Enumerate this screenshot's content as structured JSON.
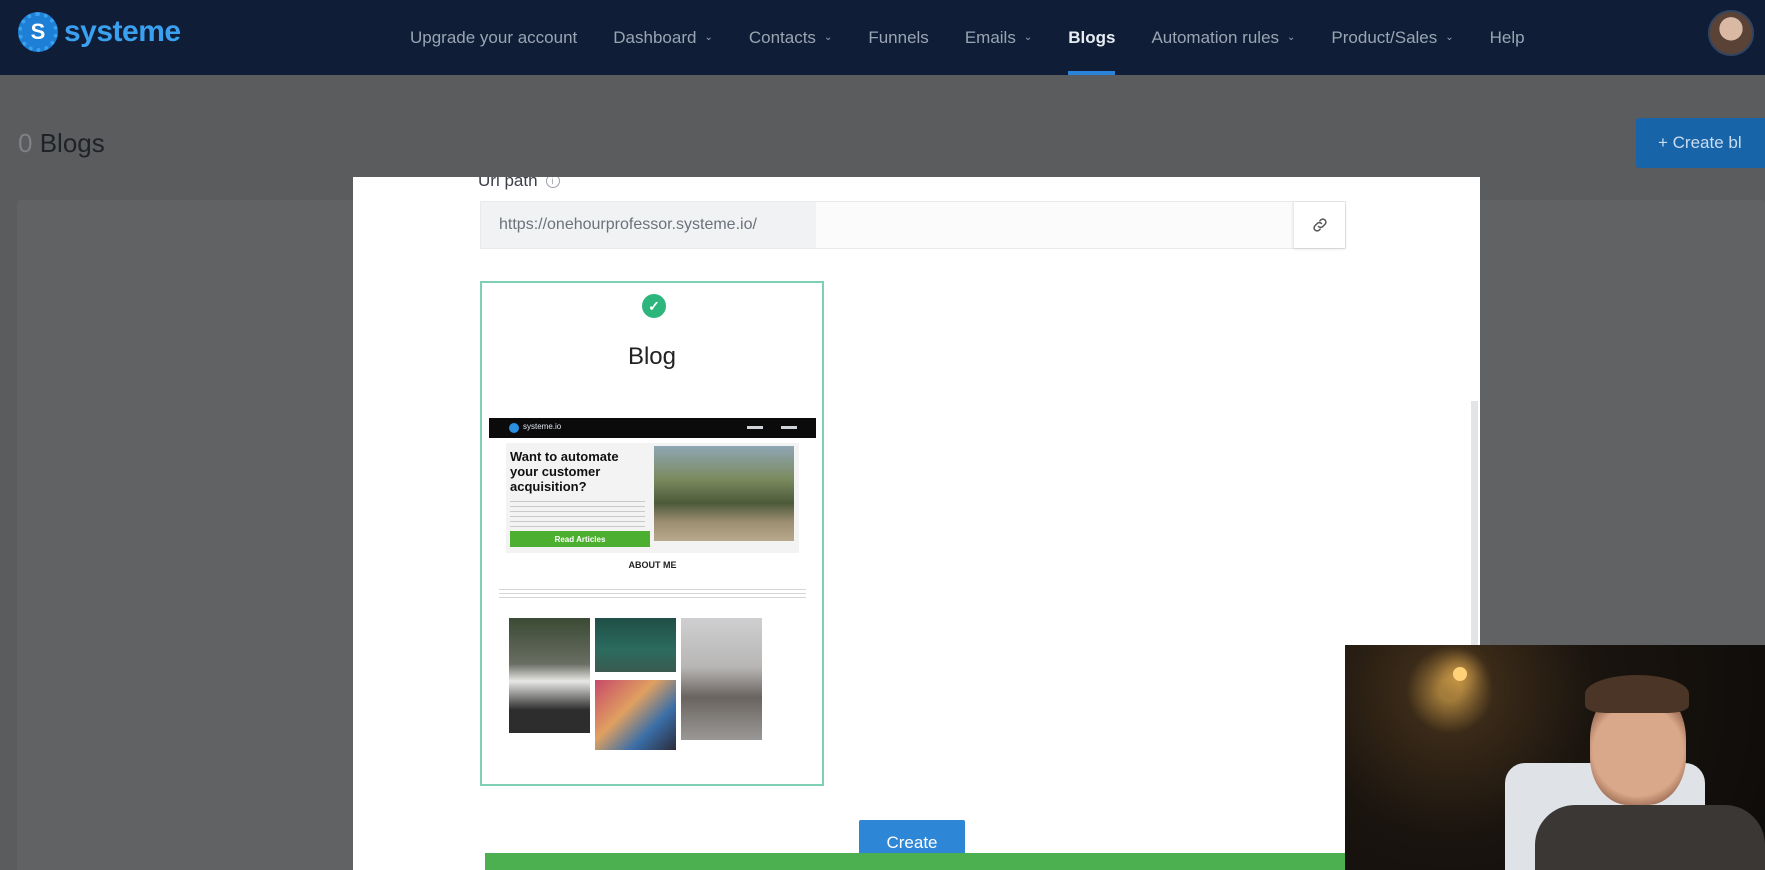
{
  "app": {
    "logo_text": "systeme",
    "nav": [
      {
        "label": "Upgrade your account",
        "has_caret": false
      },
      {
        "label": "Dashboard",
        "has_caret": true
      },
      {
        "label": "Contacts",
        "has_caret": true
      },
      {
        "label": "Funnels",
        "has_caret": false
      },
      {
        "label": "Emails",
        "has_caret": true
      },
      {
        "label": "Blogs",
        "has_caret": false,
        "active": true
      },
      {
        "label": "Automation rules",
        "has_caret": true
      },
      {
        "label": "Product/Sales",
        "has_caret": true
      },
      {
        "label": "Help",
        "has_caret": false
      }
    ],
    "caret_glyph": "⌄"
  },
  "page": {
    "count": "0",
    "title": "Blogs",
    "create_button_label": "+ Create bl"
  },
  "modal": {
    "url_label": "Url path",
    "url_prefix": "https://onehourprofessor.systeme.io/",
    "url_value": "",
    "template": {
      "title": "Blog",
      "selected": true,
      "preview_brand": "systeme.io",
      "preview_headline": "Want to automate your customer acquisition?",
      "preview_cta": "Read Articles",
      "preview_about": "ABOUT ME"
    },
    "create_label": "Create"
  },
  "colors": {
    "nav_bg": "#0f1e36",
    "accent_blue": "#2e86d6",
    "selected_border": "#7fcfb3",
    "check_green": "#2cb67d"
  }
}
